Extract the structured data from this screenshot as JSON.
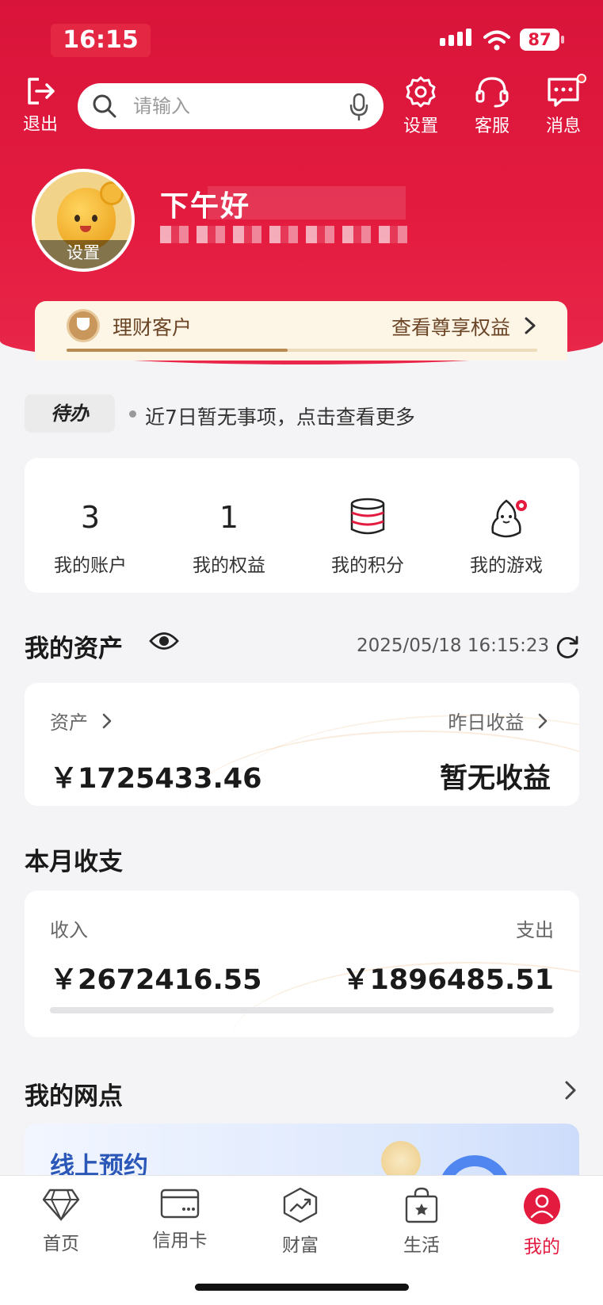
{
  "status_bar": {
    "time": "16:15",
    "battery": "87"
  },
  "topbar": {
    "logout_label": "退出",
    "search_placeholder": "请输入",
    "settings_label": "设置",
    "service_label": "客服",
    "messages_label": "消息"
  },
  "profile": {
    "avatar_label": "设置",
    "greeting": "下午好"
  },
  "vip": {
    "level": "理财客户",
    "benefits_link": "查看尊享权益",
    "progress": 0.47
  },
  "todo": {
    "tag": "待办",
    "text": "近7日暂无事项，点击查看更多"
  },
  "quick": {
    "items": [
      {
        "value": "3",
        "label": "我的账户"
      },
      {
        "value": "1",
        "label": "我的权益"
      },
      {
        "value": "",
        "label": "我的积分",
        "icon": "coins-stack-icon"
      },
      {
        "value": "",
        "label": "我的游戏",
        "icon": "mascot-game-icon"
      }
    ]
  },
  "assets": {
    "title": "我的资产",
    "timestamp": "2025/05/18 16:15:23",
    "assets_label": "资产",
    "assets_value": "￥1725433.46",
    "yesterday_label": "昨日收益",
    "yesterday_value": "暂无收益"
  },
  "monthly": {
    "title": "本月收支",
    "income_label": "收入",
    "income_value": "￥2672416.55",
    "expense_label": "支出",
    "expense_value": "￥1896485.51"
  },
  "branch": {
    "title": "我的网点",
    "booking_title": "线上预约"
  },
  "tabs": [
    {
      "label": "首页",
      "icon": "diamond-icon"
    },
    {
      "label": "信用卡",
      "icon": "credit-card-icon"
    },
    {
      "label": "财富",
      "icon": "growth-chart-icon"
    },
    {
      "label": "生活",
      "icon": "shopping-bag-icon"
    },
    {
      "label": "我的",
      "icon": "user-icon",
      "active": true
    }
  ],
  "colors": {
    "brand": "#e31b3f",
    "gold": "#b78b52",
    "link_blue": "#2a57b8"
  }
}
